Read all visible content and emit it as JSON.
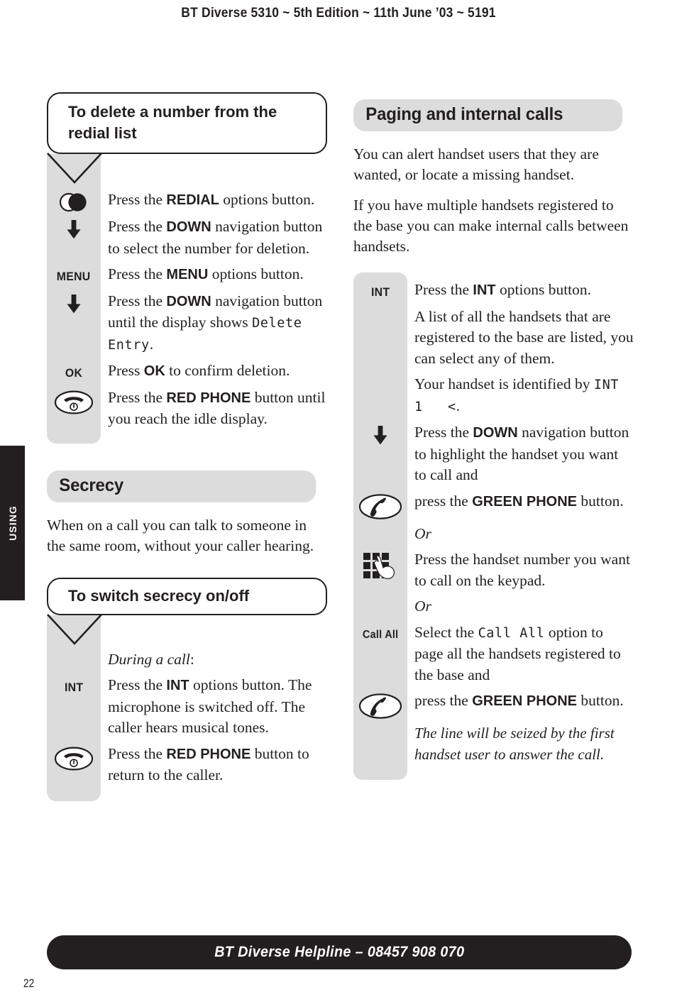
{
  "document": {
    "running_header": "BT Diverse 5310 ~ 5th Edition ~ 11th June ’03 ~ 5191",
    "thumb_tab": "USING",
    "footer": "BT Diverse Helpline – 08457 908 070",
    "page_number": "22"
  },
  "left_column": {
    "task1": {
      "title": "To delete a number from the redial list",
      "steps": [
        {
          "cue_type": "icon",
          "cue": "redial-icon",
          "text_html": "Press the <b>REDIAL</b> options button."
        },
        {
          "cue_type": "icon",
          "cue": "down-arrow-icon",
          "text_html": "Press the <b>DOWN</b> navigation button to select the number for deletion."
        },
        {
          "cue_type": "label",
          "cue": "MENU",
          "text_html": "Press the <b>MENU</b> options button."
        },
        {
          "cue_type": "icon",
          "cue": "down-arrow-icon",
          "text_html": "Press the <b>DOWN</b> navigation button until the display shows <span class=\"lcd\">Delete Entry</span>."
        },
        {
          "cue_type": "label",
          "cue": "OK",
          "text_html": "Press <b>OK</b> to confirm deletion."
        },
        {
          "cue_type": "icon",
          "cue": "red-phone-icon",
          "text_html": "Press the <b>RED PHONE</b> button until you reach the idle display."
        }
      ]
    },
    "section2": {
      "heading": "Secrecy",
      "paragraphs": [
        "When on a call you can talk to someone in the same room, without your caller hearing."
      ],
      "task": {
        "title": "To switch secrecy on/off",
        "steps": [
          {
            "cue_type": "none",
            "cue": "",
            "text_html": "<i>During a call</i>:"
          },
          {
            "cue_type": "label",
            "cue": "INT",
            "text_html": "Press the <b>INT</b> options button. The microphone is switched off. The caller hears musical tones."
          },
          {
            "cue_type": "icon",
            "cue": "red-phone-icon",
            "text_html": "Press the <b>RED PHONE</b> button to return to the caller."
          }
        ]
      }
    }
  },
  "right_column": {
    "heading": "Paging and internal calls",
    "paragraphs": [
      "You can alert handset users that they are wanted, or locate a missing handset.",
      "If you have multiple handsets registered to the base you can make internal calls between handsets."
    ],
    "steps": [
      {
        "cue_type": "label",
        "cue": "INT",
        "text_html": "Press the <b>INT</b> options button."
      },
      {
        "cue_type": "none",
        "cue": "",
        "text_html": "A list of all the handsets that are registered to the base are listed, you can select any of them."
      },
      {
        "cue_type": "none",
        "cue": "",
        "text_html": "Your handset is identified by <span class=\"lcd\">INT 1&nbsp;&nbsp;&nbsp;&lt;</span>."
      },
      {
        "cue_type": "icon",
        "cue": "down-arrow-icon",
        "text_html": "Press the <b>DOWN</b> navigation button to highlight the handset you want to call and"
      },
      {
        "cue_type": "icon",
        "cue": "green-phone-icon",
        "text_html": "press the <b>GREEN PHONE</b> button."
      },
      {
        "cue_type": "none",
        "cue": "",
        "text_html": "<i>Or</i>"
      },
      {
        "cue_type": "icon",
        "cue": "keypad-icon",
        "text_html": "Press the handset number you want to call on the keypad."
      },
      {
        "cue_type": "none",
        "cue": "",
        "text_html": "<i>Or</i>"
      },
      {
        "cue_type": "label",
        "cue": "Call All",
        "text_html": "Select the <span class=\"lcd\">Call All</span> option to page all the handsets registered to the base and"
      },
      {
        "cue_type": "icon",
        "cue": "green-phone-icon",
        "text_html": "press the <b>GREEN PHONE</b> button."
      },
      {
        "cue_type": "none",
        "cue": "",
        "text_html": "<span class=\"note-italic\">The line will be seized by the first handset user to answer the call.</span>"
      }
    ]
  }
}
